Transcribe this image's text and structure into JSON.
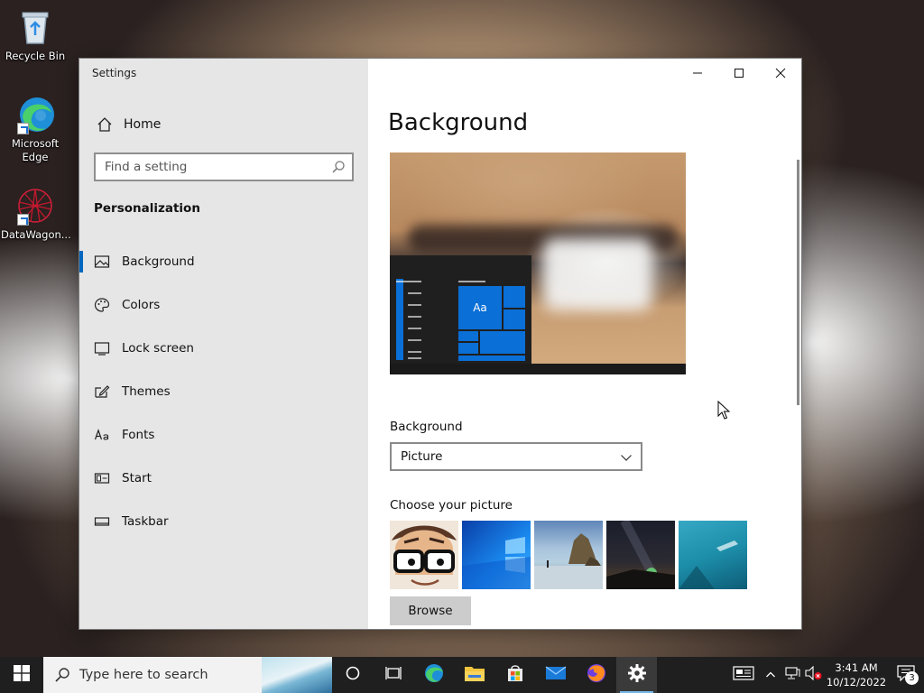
{
  "desktop": {
    "icons": [
      {
        "label": "Recycle Bin",
        "icon": "recycle-bin-icon"
      },
      {
        "label": "Microsoft Edge",
        "icon": "edge-icon"
      },
      {
        "label": "DataWagon...",
        "icon": "datawagon-icon"
      }
    ]
  },
  "window": {
    "title": "Settings",
    "controls": {
      "minimize": "minimize-icon",
      "maximize": "maximize-icon",
      "close": "close-icon"
    }
  },
  "sidebar": {
    "home_label": "Home",
    "search_placeholder": "Find a setting",
    "section_title": "Personalization",
    "items": [
      {
        "label": "Background",
        "icon": "picture-icon",
        "selected": true
      },
      {
        "label": "Colors",
        "icon": "palette-icon",
        "selected": false
      },
      {
        "label": "Lock screen",
        "icon": "lock-screen-icon",
        "selected": false
      },
      {
        "label": "Themes",
        "icon": "themes-icon",
        "selected": false
      },
      {
        "label": "Fonts",
        "icon": "fonts-icon",
        "selected": false
      },
      {
        "label": "Start",
        "icon": "start-icon",
        "selected": false
      },
      {
        "label": "Taskbar",
        "icon": "taskbar-icon",
        "selected": false
      }
    ]
  },
  "main": {
    "title": "Background",
    "preview_tile_text": "Aa",
    "background_label": "Background",
    "background_value": "Picture",
    "choose_label": "Choose your picture",
    "browse_label": "Browse"
  },
  "taskbar": {
    "search_text": "Type here to search",
    "time": "3:41 AM",
    "date": "10/12/2022",
    "notification_count": "3"
  },
  "colors": {
    "accent": "#0067c0",
    "sidebar_bg": "#e6e6e6",
    "taskbar_bg": "#1f1f1f",
    "tile_blue": "#0a6fd6"
  }
}
